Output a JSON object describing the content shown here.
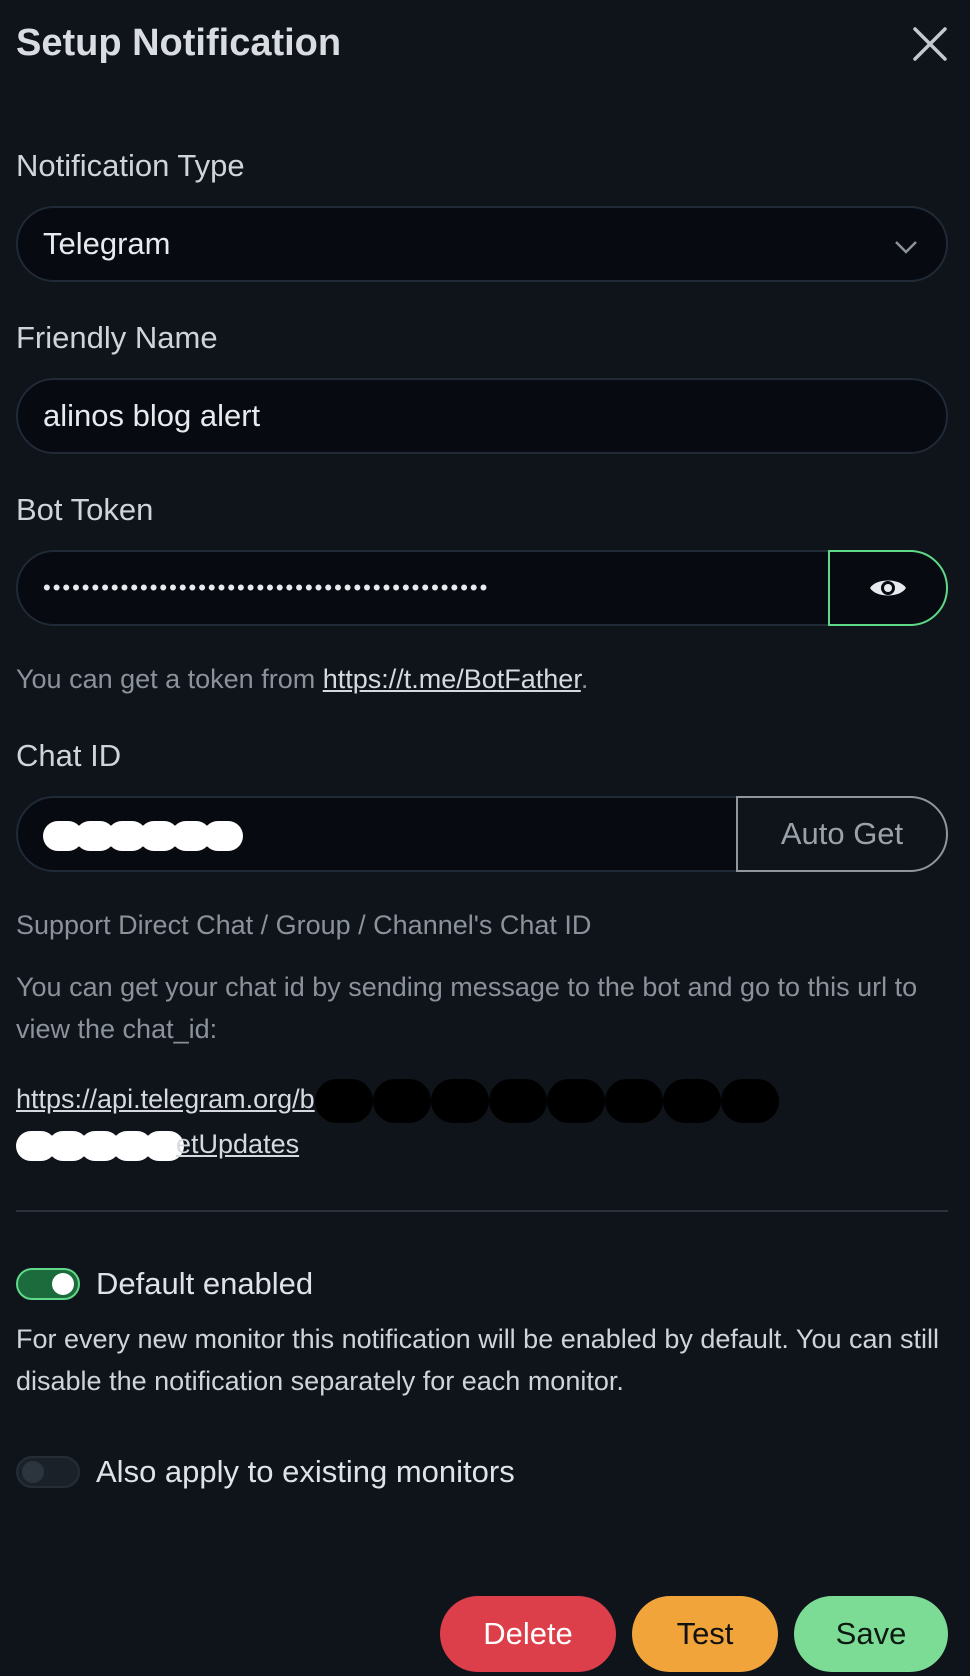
{
  "modal": {
    "title": "Setup Notification"
  },
  "notification_type": {
    "label": "Notification Type",
    "value": "Telegram"
  },
  "friendly_name": {
    "label": "Friendly Name",
    "value": "alinos blog alert"
  },
  "bot_token": {
    "label": "Bot Token",
    "masked_value": "••••••••••••••••••••••••••••••••••••••••••••••",
    "help_prefix": "You can get a token from ",
    "help_link": "https://t.me/BotFather",
    "help_suffix": "."
  },
  "chat_id": {
    "label": "Chat ID",
    "auto_get_label": "Auto Get",
    "support_text": "Support Direct Chat / Group / Channel's Chat ID",
    "help_text": "You can get your chat id by sending message to the bot and go to this url to view the chat_id:",
    "url_prefix": "https://api.telegram.org/b",
    "url_suffix": "etUpdates"
  },
  "default_enabled": {
    "label": "Default enabled",
    "checked": true,
    "description": "For every new monitor this notification will be enabled by default. You can still disable the notification separately for each monitor."
  },
  "apply_existing": {
    "label": "Also apply to existing monitors",
    "checked": false
  },
  "footer": {
    "delete_label": "Delete",
    "test_label": "Test",
    "save_label": "Save"
  },
  "colors": {
    "background": "#0f131a",
    "accent": "#5fd88a",
    "danger": "#dc3f4a",
    "warning": "#f0a43a",
    "success": "#7cdb95"
  }
}
